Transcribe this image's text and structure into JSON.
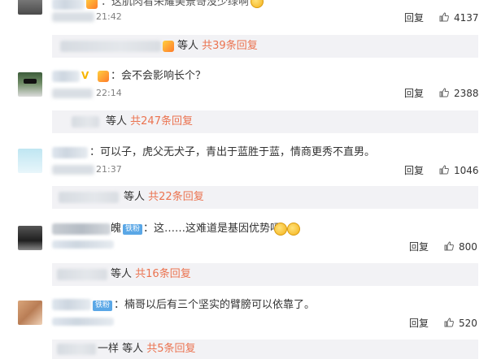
{
  "comments": [
    {
      "text": "：这肌肉看荣耀美景哥没少绿啊",
      "time": "21:42",
      "reply": "回复",
      "likes": "4137",
      "sub": {
        "who": "等人",
        "count": "共39条回复"
      }
    },
    {
      "text": "：会不会影响长个？",
      "time": "22:14",
      "reply": "回复",
      "likes": "2388",
      "sub": {
        "who": "等人",
        "count": "共247条回复"
      }
    },
    {
      "text": "：可以子，虎父无犬子，青出于蓝胜于蓝，情商更秀不直男。",
      "time": "21:37",
      "reply": "回复",
      "likes": "1046",
      "sub": {
        "who": "等人",
        "count": "共22条回复"
      }
    },
    {
      "name_tail": "魄",
      "badge": "铁粉",
      "text": "：这……这难道是基因优势吗",
      "reply": "回复",
      "likes": "800",
      "sub": {
        "who": "等人",
        "count": "共16条回复"
      }
    },
    {
      "badge": "铁粉",
      "text": "：楠哥以后有三个坚实的臂膀可以依靠了。",
      "reply": "回复",
      "likes": "520",
      "sub": {
        "who": "一样  等人",
        "count": "共5条回复"
      }
    }
  ],
  "icons": {
    "like": "thumbs-up-icon",
    "vip": "vip-v-icon",
    "emoji": "laughing-emoji-icon"
  },
  "colors": {
    "accent": "#eb7350",
    "reply_bg": "#f2f2f5",
    "badge": "#5aa7e6"
  }
}
